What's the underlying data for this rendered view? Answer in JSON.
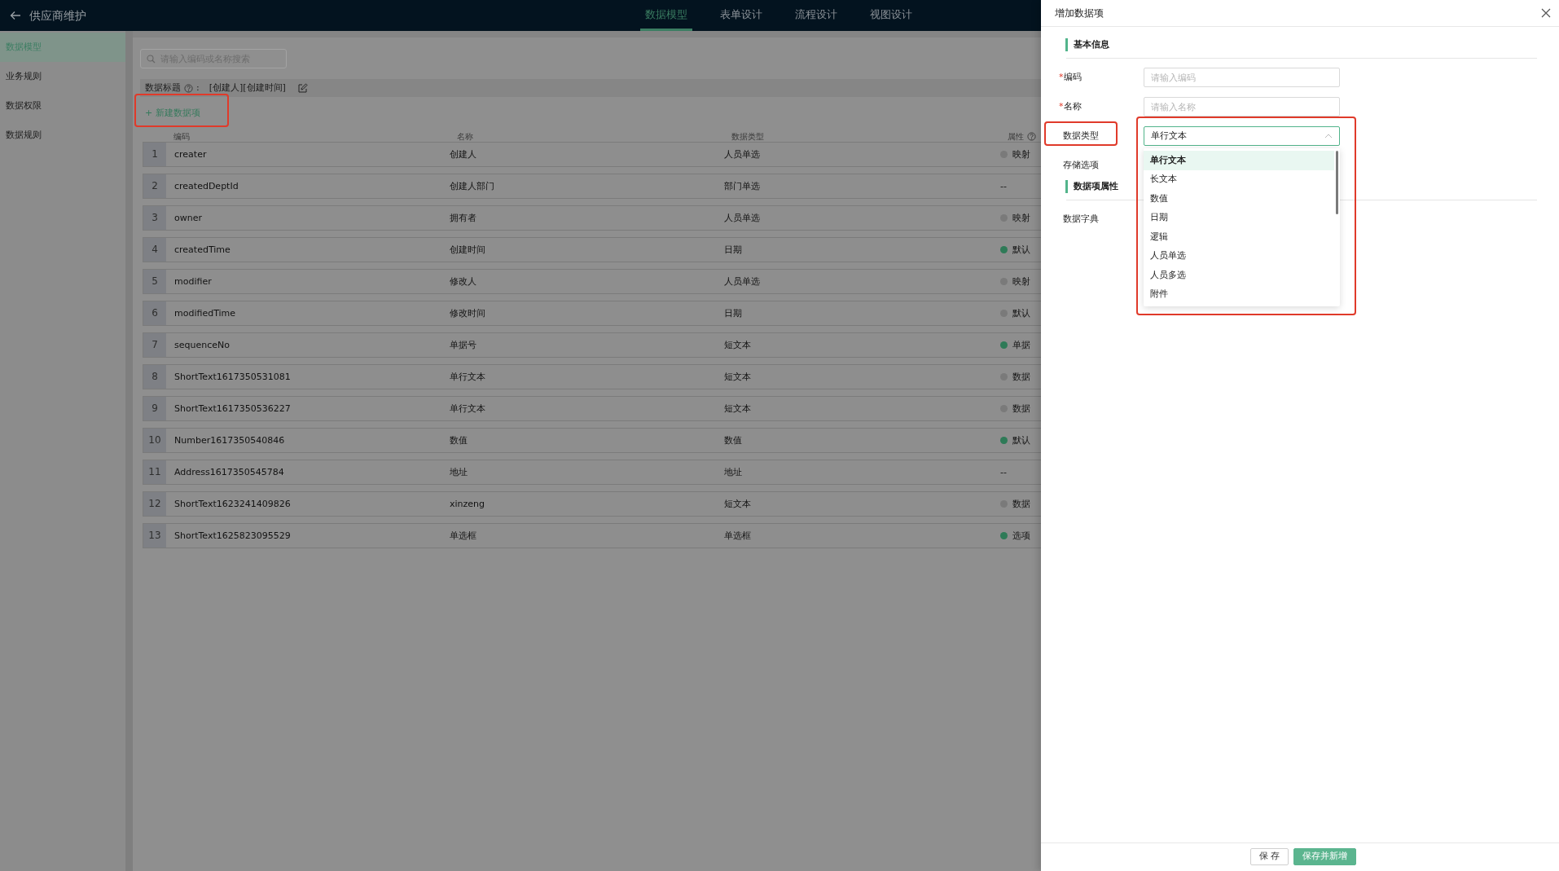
{
  "header": {
    "title": "供应商维护",
    "tabs": [
      {
        "label": "数据模型",
        "selected": true
      },
      {
        "label": "表单设计",
        "selected": false
      },
      {
        "label": "流程设计",
        "selected": false
      },
      {
        "label": "视图设计",
        "selected": false
      }
    ]
  },
  "sidebar": {
    "items": [
      {
        "label": "数据模型",
        "selected": true
      },
      {
        "label": "业务规则",
        "selected": false
      },
      {
        "label": "数据权限",
        "selected": false
      },
      {
        "label": "数据规则",
        "selected": false
      }
    ]
  },
  "search": {
    "placeholder": "请输入编码或名称搜索"
  },
  "data_title": {
    "label": "数据标题",
    "suffix": ":",
    "value": "[创建人][创建时间]"
  },
  "new_button": {
    "label": "+ 新建数据项",
    "highlighted": true
  },
  "table": {
    "columns": [
      "编码",
      "名称",
      "数据类型",
      "属性"
    ],
    "rows": [
      {
        "index": "1",
        "code": "creater",
        "name": "创建人",
        "type": "人员单选",
        "attribute": {
          "text": "映射",
          "on": false
        }
      },
      {
        "index": "2",
        "code": "createdDeptId",
        "name": "创建人部门",
        "type": "部门单选",
        "attribute": "--"
      },
      {
        "index": "3",
        "code": "owner",
        "name": "拥有者",
        "type": "人员单选",
        "attribute": {
          "text": "映射",
          "on": false
        }
      },
      {
        "index": "4",
        "code": "createdTime",
        "name": "创建时间",
        "type": "日期",
        "attribute": {
          "text": "默认",
          "on": true
        }
      },
      {
        "index": "5",
        "code": "modifier",
        "name": "修改人",
        "type": "人员单选",
        "attribute": {
          "text": "映射",
          "on": false
        }
      },
      {
        "index": "6",
        "code": "modifiedTime",
        "name": "修改时间",
        "type": "日期",
        "attribute": {
          "text": "默认",
          "on": false
        }
      },
      {
        "index": "7",
        "code": "sequenceNo",
        "name": "单据号",
        "type": "短文本",
        "attribute": {
          "text": "单据",
          "on": true
        }
      },
      {
        "index": "8",
        "code": "ShortText1617350531081",
        "name": "单行文本",
        "type": "短文本",
        "attribute": {
          "text": "数据",
          "on": false
        }
      },
      {
        "index": "9",
        "code": "ShortText1617350536227",
        "name": "单行文本",
        "type": "短文本",
        "attribute": {
          "text": "数据",
          "on": false
        }
      },
      {
        "index": "10",
        "code": "Number1617350540846",
        "name": "数值",
        "type": "数值",
        "attribute": {
          "text": "默认",
          "on": true
        }
      },
      {
        "index": "11",
        "code": "Address1617350545784",
        "name": "地址",
        "type": "地址",
        "attribute": "--"
      },
      {
        "index": "12",
        "code": "ShortText1623241409826",
        "name": "xinzeng",
        "type": "短文本",
        "attribute": {
          "text": "数据",
          "on": false
        }
      },
      {
        "index": "13",
        "code": "ShortText1625823095529",
        "name": "单选框",
        "type": "单选框",
        "attribute": {
          "text": "选项",
          "on": true
        }
      }
    ]
  },
  "drawer": {
    "title": "增加数据项",
    "sections": [
      {
        "title": "基本信息",
        "fields": [
          {
            "kind": "input",
            "label": "编码",
            "marker": "*",
            "highlighted": false,
            "placeholder": "请输入编码"
          },
          {
            "kind": "input",
            "label": "名称",
            "marker": "*",
            "highlighted": false,
            "placeholder": "请输入名称"
          },
          {
            "kind": "select",
            "label": "数据类型",
            "highlighted": true,
            "value": "单行文本",
            "expanded": true
          },
          {
            "kind": "plain",
            "label": "存储选项",
            "highlighted": false
          }
        ]
      },
      {
        "title": "数据项属性",
        "fields": [
          {
            "kind": "plain",
            "label": "数据字典",
            "highlighted": false
          }
        ]
      }
    ],
    "dropdown": {
      "highlighted": true,
      "options": [
        {
          "label": "单行文本",
          "selected": true
        },
        {
          "label": "长文本",
          "selected": false
        },
        {
          "label": "数值",
          "selected": false
        },
        {
          "label": "日期",
          "selected": false
        },
        {
          "label": "逻辑",
          "selected": false
        },
        {
          "label": "人员单选",
          "selected": false
        },
        {
          "label": "人员多选",
          "selected": false
        },
        {
          "label": "附件",
          "selected": false
        }
      ]
    },
    "buttons": [
      {
        "label": "保 存",
        "primary": false
      },
      {
        "label": "保存并新增",
        "primary": true
      }
    ]
  }
}
